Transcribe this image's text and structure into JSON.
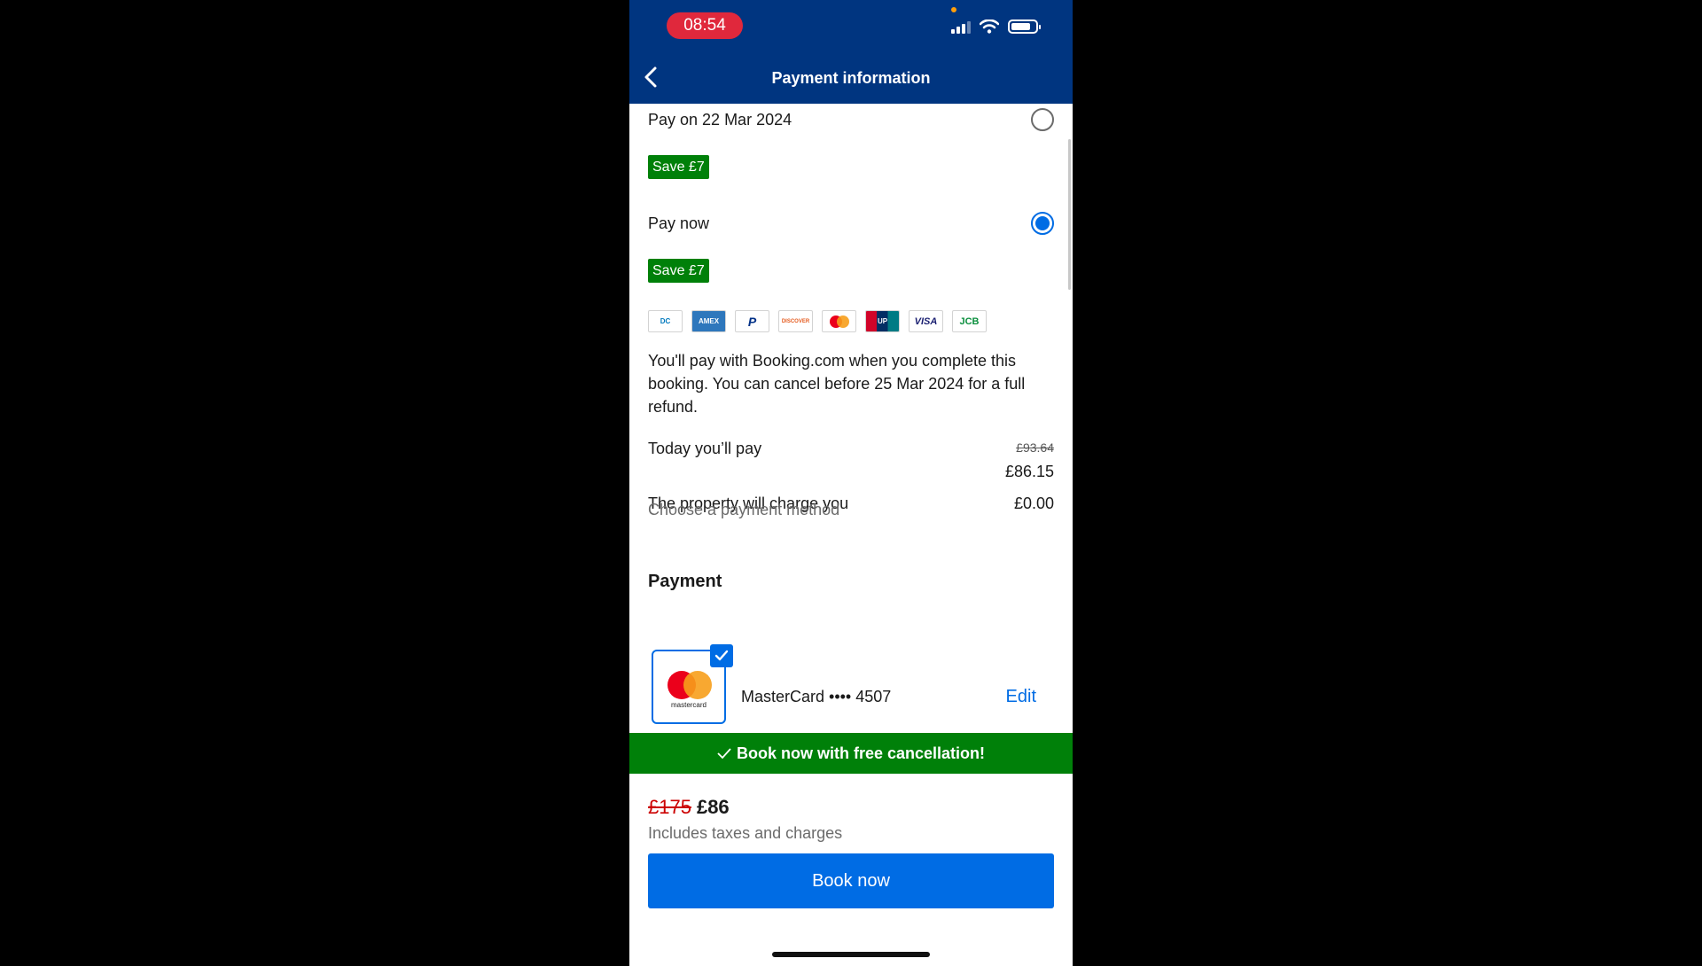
{
  "status_bar": {
    "time": "08:54"
  },
  "header": {
    "title": "Payment information"
  },
  "options": [
    {
      "label": "Pay on 22 Mar 2024",
      "badge": "Save £7",
      "selected": false
    },
    {
      "label": "Pay now",
      "badge": "Save £7",
      "selected": true
    }
  ],
  "card_brands": [
    {
      "name": "Diners Club",
      "icon": "diners-icon",
      "text": "DC",
      "color": "#0079be"
    },
    {
      "name": "American Express",
      "icon": "amex-icon",
      "text": "AMEX",
      "color": "#2e77bc"
    },
    {
      "name": "PayPal",
      "icon": "paypal-icon",
      "text": "P",
      "color": "#003087"
    },
    {
      "name": "Discover",
      "icon": "discover-icon",
      "text": "DISCOVER",
      "color": "#e55c20"
    },
    {
      "name": "MasterCard",
      "icon": "mastercard-icon",
      "text": "MC",
      "color": "#eb001b"
    },
    {
      "name": "UnionPay",
      "icon": "unionpay-icon",
      "text": "UP",
      "color": "#d10429"
    },
    {
      "name": "Visa",
      "icon": "visa-icon",
      "text": "VISA",
      "color": "#1a1f71"
    },
    {
      "name": "JCB",
      "icon": "jcb-icon",
      "text": "JCB",
      "color": "#0b8f3e"
    }
  ],
  "info_text": "You'll pay with Booking.com when you complete this booking. You can cancel before 25 Mar 2024 for a full refund.",
  "summary": {
    "today_label": "Today you’ll pay",
    "today_old": "£93.64",
    "today_value": "£86.15",
    "property_label": "The property will charge you",
    "property_value": "£0.00"
  },
  "payment": {
    "title": "Payment",
    "subtitle": "Choose a payment method",
    "card_word": "mastercard",
    "card_label": "MasterCard •••• 4507",
    "edit_label": "Edit"
  },
  "promo": {
    "text": "Book now with free cancellation!"
  },
  "footer": {
    "old_price": "£175",
    "price": "£86",
    "tax_note": "Includes taxes and charges",
    "button_label": "Book now"
  },
  "colors": {
    "brand_blue": "#003580",
    "action_blue": "#006ce4",
    "green": "#008009"
  }
}
